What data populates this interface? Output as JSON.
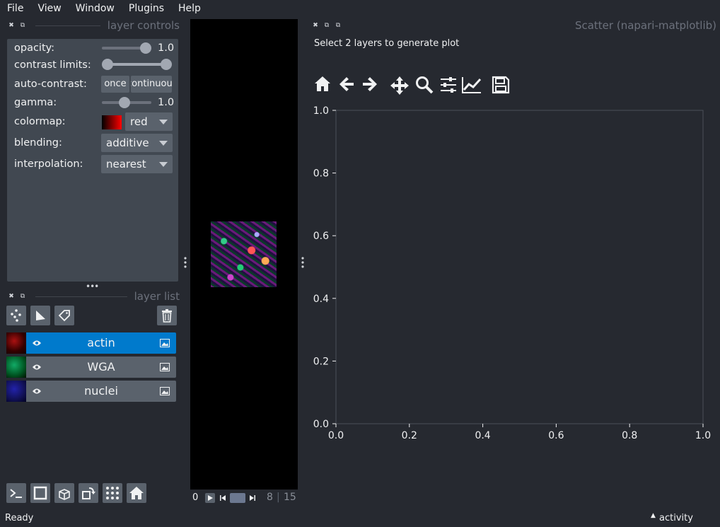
{
  "menu": [
    "File",
    "View",
    "Window",
    "Plugins",
    "Help"
  ],
  "layer_controls": {
    "title": "layer controls",
    "opacity_label": "opacity:",
    "opacity_value": "1.0",
    "opacity_level": 1.0,
    "contrast_label": "contrast limits:",
    "contrast_range": [
      0,
      1
    ],
    "auto_contrast_label": "auto-contrast:",
    "once_label": "once",
    "continuous_label": "continuous",
    "gamma_label": "gamma:",
    "gamma_value": "1.0",
    "gamma_level": 0.5,
    "colormap_label": "colormap:",
    "colormap_value": "red",
    "blending_label": "blending:",
    "blending_value": "additive",
    "interpolation_label": "interpolation:",
    "interpolation_value": "nearest"
  },
  "layer_list": {
    "title": "layer list",
    "layers": [
      {
        "name": "actin",
        "selected": true,
        "color": "#cc2020"
      },
      {
        "name": "WGA",
        "selected": false,
        "color": "#20a020"
      },
      {
        "name": "nuclei",
        "selected": false,
        "color": "#2020b0"
      }
    ]
  },
  "dims": {
    "axis_index": "0",
    "current": "8",
    "separator": "|",
    "total": "15"
  },
  "plot": {
    "title": "Scatter (napari-matplotlib)",
    "instruction": "Select 2 layers to generate plot",
    "toolbar": [
      "home-icon",
      "back-icon",
      "forward-icon",
      "pan-icon",
      "zoom-icon",
      "configure-subplots-icon",
      "edit-axis-icon",
      "save-icon"
    ]
  },
  "chart_data": {
    "type": "scatter",
    "title": "",
    "xlabel": "",
    "ylabel": "",
    "xlim": [
      0.0,
      1.0
    ],
    "ylim": [
      0.0,
      1.0
    ],
    "xticks": [
      "0.0",
      "0.2",
      "0.4",
      "0.6",
      "0.8",
      "1.0"
    ],
    "yticks": [
      "0.0",
      "0.2",
      "0.4",
      "0.6",
      "0.8",
      "1.0"
    ],
    "series": []
  },
  "status": {
    "left": "Ready",
    "activity": "activity"
  }
}
